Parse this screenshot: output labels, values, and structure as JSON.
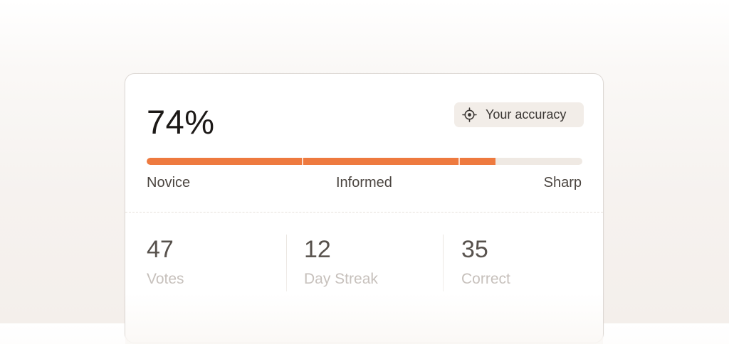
{
  "accuracy": {
    "value_text": "74%",
    "progress_percent": 80,
    "badge_label": "Your accuracy",
    "badge_icon": "target-icon",
    "accent_color": "#ee7a3f"
  },
  "levels": {
    "novice": "Novice",
    "informed": "Informed",
    "sharp": "Sharp"
  },
  "stats": {
    "votes": {
      "value": "47",
      "label": "Votes"
    },
    "streak": {
      "value": "12",
      "label": "Day Streak"
    },
    "correct": {
      "value": "35",
      "label": "Correct"
    }
  }
}
